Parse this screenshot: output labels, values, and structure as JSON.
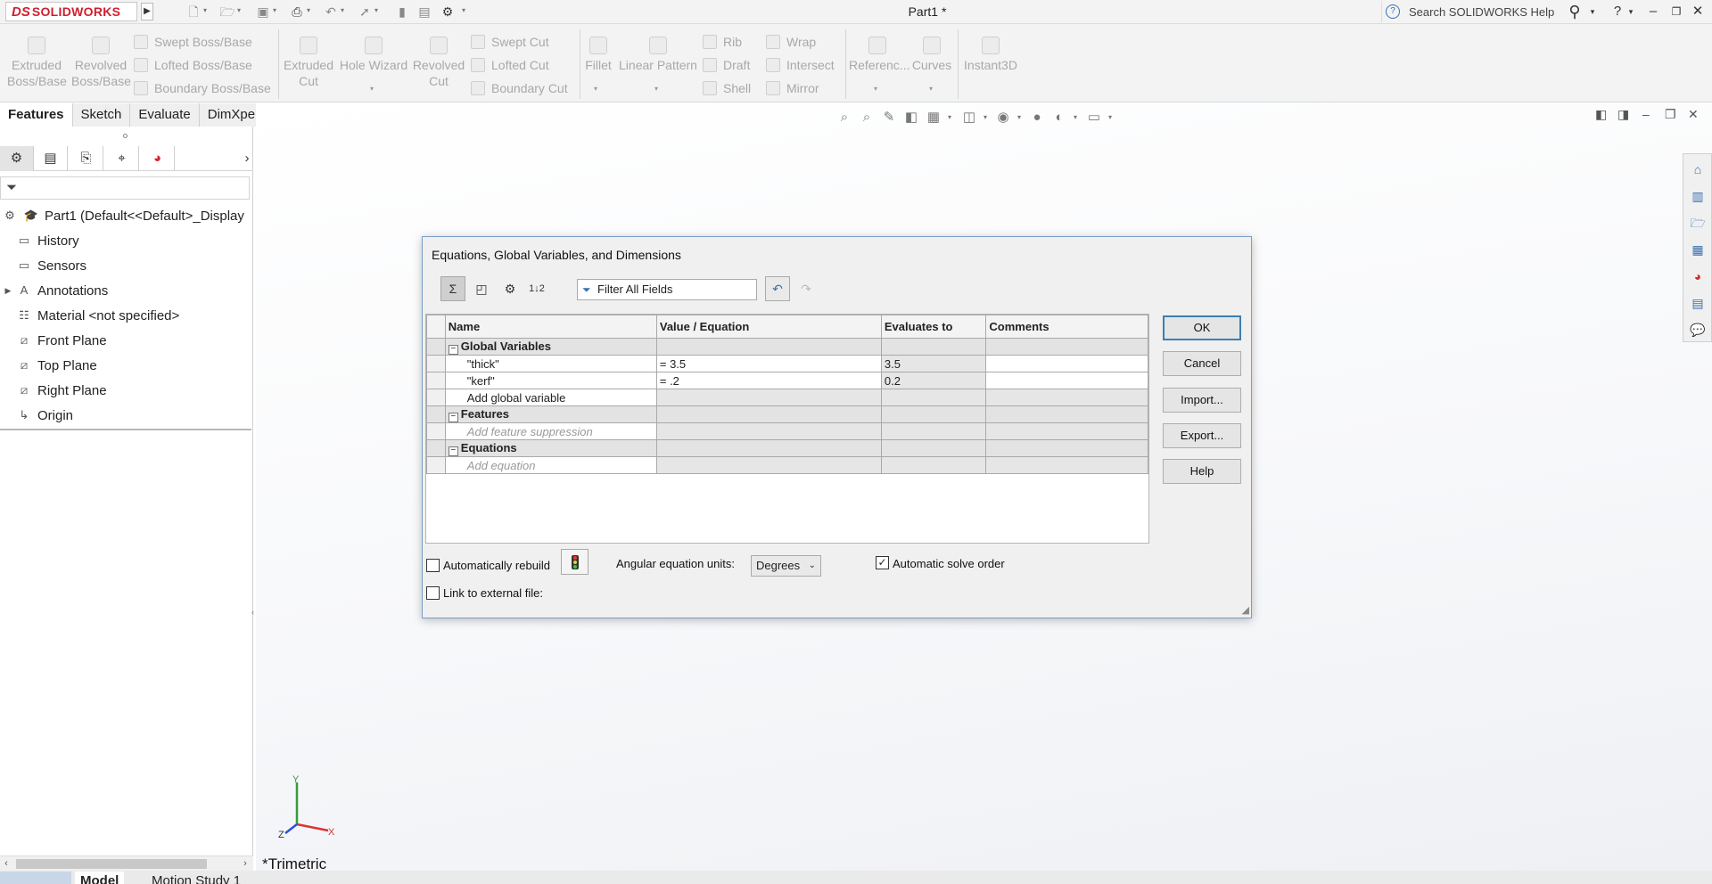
{
  "app": {
    "logo_ds": "DS",
    "logo_name": "SOLIDWORKS",
    "doc_title": "Part1 *",
    "search_placeholder": "Search SOLIDWORKS Help"
  },
  "toolbar": {
    "extruded_boss": [
      "Extruded",
      "Boss/Base"
    ],
    "revolved_boss": [
      "Revolved",
      "Boss/Base"
    ],
    "swept_boss": "Swept Boss/Base",
    "lofted_boss": "Lofted Boss/Base",
    "boundary_boss": "Boundary Boss/Base",
    "extruded_cut": [
      "Extruded",
      "Cut"
    ],
    "hole_wizard": "Hole Wizard",
    "revolved_cut": [
      "Revolved",
      "Cut"
    ],
    "swept_cut": "Swept Cut",
    "lofted_cut": "Lofted Cut",
    "boundary_cut": "Boundary Cut",
    "fillet": "Fillet",
    "linear_pattern": "Linear Pattern",
    "rib": "Rib",
    "draft": "Draft",
    "shell": "Shell",
    "wrap": "Wrap",
    "intersect": "Intersect",
    "mirror": "Mirror",
    "reference": "Referenc...",
    "curves": "Curves",
    "instant3d": "Instant3D"
  },
  "tabs": [
    "Features",
    "Sketch",
    "Evaluate",
    "DimXpert"
  ],
  "tree": {
    "root": "Part1  (Default<<Default>_Display",
    "items": [
      "History",
      "Sensors",
      "Annotations",
      "Material <not specified>",
      "Front Plane",
      "Top Plane",
      "Right Plane",
      "Origin"
    ]
  },
  "graphics": {
    "view_label": "*Trimetric",
    "axis_x": "X",
    "axis_y": "Y",
    "axis_z": "Z"
  },
  "bottom_tabs": [
    "Model",
    "Motion Study 1"
  ],
  "dialog": {
    "title": "Equations, Global Variables, and Dimensions",
    "filter_text": "Filter All Fields",
    "columns": [
      "Name",
      "Value / Equation",
      "Evaluates to",
      "Comments"
    ],
    "groups": {
      "global_variables": "Global Variables",
      "features": "Features",
      "equations": "Equations"
    },
    "rows": [
      {
        "name": "\"thick\"",
        "value": "= 3.5",
        "evaluates": "3.5",
        "comment": ""
      },
      {
        "name": "\"kerf\"",
        "value": "= .2",
        "evaluates": "0.2",
        "comment": ""
      }
    ],
    "add_global_variable": "Add global variable",
    "add_feature_suppression": "Add feature suppression",
    "add_equation": "Add equation",
    "buttons": {
      "ok": "OK",
      "cancel": "Cancel",
      "import": "Import...",
      "export": "Export...",
      "help": "Help"
    },
    "auto_rebuild_label": "Automatically rebuild",
    "angular_units_label": "Angular equation units:",
    "angular_units_value": "Degrees",
    "auto_solve_label": "Automatic solve order",
    "auto_solve_checked": true,
    "auto_rebuild_checked": false,
    "link_external_label": "Link to external file:",
    "link_external_checked": false
  }
}
